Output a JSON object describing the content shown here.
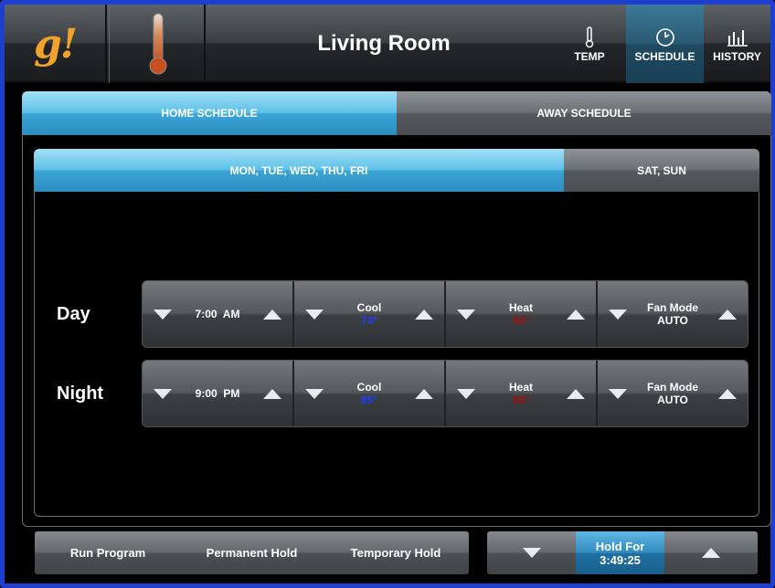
{
  "header": {
    "logo_text": "g!",
    "room_title": "Living Room",
    "nav": [
      {
        "label": "TEMP",
        "icon": "thermometer-icon"
      },
      {
        "label": "SCHEDULE",
        "icon": "clock-icon",
        "active": true
      },
      {
        "label": "HISTORY",
        "icon": "bar-chart-icon"
      }
    ]
  },
  "schedule_tabs": [
    {
      "label": "HOME SCHEDULE",
      "active": true
    },
    {
      "label": "AWAY SCHEDULE",
      "active": false
    }
  ],
  "day_tabs": [
    {
      "label": "MON, TUE, WED, THU, FRI",
      "active": true
    },
    {
      "label": "SAT, SUN",
      "active": false
    }
  ],
  "rows": [
    {
      "label": "Day",
      "time": "7:00  AM",
      "cool_label": "Cool",
      "cool_value": "74°",
      "heat_label": "Heat",
      "heat_value": "68°",
      "fan_label": "Fan Mode",
      "fan_value": "AUTO"
    },
    {
      "label": "Night",
      "time": "9:00  PM",
      "cool_label": "Cool",
      "cool_value": "85°",
      "heat_label": "Heat",
      "heat_value": "60°",
      "fan_label": "Fan Mode",
      "fan_value": "AUTO"
    }
  ],
  "bottom": {
    "run_program": "Run Program",
    "permanent_hold": "Permanent Hold",
    "temporary_hold": "Temporary Hold",
    "hold_for_label": "Hold For",
    "hold_for_value": "3:49:25"
  },
  "colors": {
    "accent_blue": "#3aa4d6",
    "frame_blue": "#1c3fd0",
    "logo_orange": "#f0a22a",
    "cool_blue": "#1e3cff",
    "heat_red": "#a01010"
  }
}
